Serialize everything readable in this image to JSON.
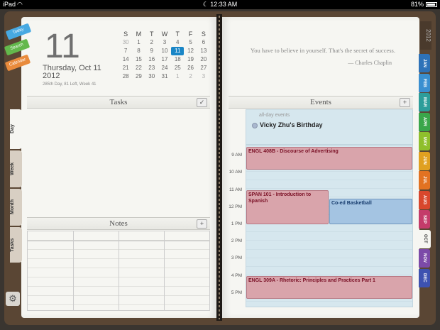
{
  "statusbar": {
    "device": "iPad",
    "time": "12:33 AM",
    "battery": "81%"
  },
  "header": {
    "day_number": "11",
    "long_date": "Thursday, Oct 11",
    "year": "2012",
    "day_info": "285th Day, 81 Left, Week 41"
  },
  "mini_calendar": {
    "weekdays": [
      "S",
      "M",
      "T",
      "W",
      "T",
      "F",
      "S"
    ],
    "weeks": [
      [
        "30",
        "1",
        "2",
        "3",
        "4",
        "5",
        "6"
      ],
      [
        "7",
        "8",
        "9",
        "10",
        "11",
        "12",
        "13"
      ],
      [
        "14",
        "15",
        "16",
        "17",
        "18",
        "19",
        "20"
      ],
      [
        "21",
        "22",
        "23",
        "24",
        "25",
        "26",
        "27"
      ],
      [
        "28",
        "29",
        "30",
        "31",
        "1",
        "2",
        "3"
      ]
    ],
    "today": "11"
  },
  "sticky_tabs": {
    "today": "Today",
    "search": "Search",
    "calendar": "Calendar"
  },
  "side_tabs": {
    "day": "Day",
    "week": "Week",
    "month": "Month",
    "tasks": "Tasks"
  },
  "sections": {
    "tasks": "Tasks",
    "notes": "Notes",
    "events": "Events"
  },
  "icons": {
    "settings": "gear-icon",
    "tasks_check": "checkmark-icon",
    "add": "plus-icon"
  },
  "quote": {
    "text": "You have to believe in yourself. That's the secret of success.",
    "author": "— Charles Chaplin"
  },
  "all_day": {
    "label": "all-day events",
    "event": "Vicky Zhu's Birthday"
  },
  "hours": [
    "9 AM",
    "10 AM",
    "11 AM",
    "12 PM",
    "1 PM",
    "2 PM",
    "3 PM",
    "4 PM",
    "5 PM"
  ],
  "events": [
    {
      "title": "ENGL 408B - Discourse of Advertising",
      "color": "#d9a4ab"
    },
    {
      "title": "SPAN 101 - Introduction to Spanish",
      "color": "#d9a4ab"
    },
    {
      "title": "Co-ed Basketball",
      "color": "#a4c4e2"
    },
    {
      "title": "ENGL 309A - Rhetoric: Principles and Practices Part 1",
      "color": "#d9a4ab"
    }
  ],
  "year_tab": "2012",
  "months": [
    {
      "label": "JAN",
      "color": "#2e72b8"
    },
    {
      "label": "FEB",
      "color": "#3a8fd0"
    },
    {
      "label": "MAR",
      "color": "#2d9d9a"
    },
    {
      "label": "APR",
      "color": "#3aa64a"
    },
    {
      "label": "MAY",
      "color": "#8fbf2c"
    },
    {
      "label": "JUN",
      "color": "#e0a020"
    },
    {
      "label": "JUL",
      "color": "#e27222"
    },
    {
      "label": "AUG",
      "color": "#d8472c"
    },
    {
      "label": "SEP",
      "color": "#c43b6a"
    },
    {
      "label": "OCT",
      "color": "#e29a30"
    },
    {
      "label": "NOV",
      "color": "#7c4aa8"
    },
    {
      "label": "DEC",
      "color": "#3d52b0"
    }
  ],
  "active_month": "OCT"
}
